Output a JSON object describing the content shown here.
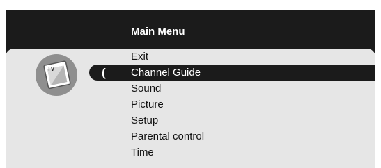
{
  "menu": {
    "title": "Main Menu",
    "icon": "tv-icon",
    "icon_label": "TV",
    "cursor_glyph": "(",
    "selected_index": 1,
    "items": [
      {
        "label": "Exit"
      },
      {
        "label": "Channel Guide"
      },
      {
        "label": "Sound"
      },
      {
        "label": "Picture"
      },
      {
        "label": "Setup"
      },
      {
        "label": "Parental control"
      },
      {
        "label": "Time"
      }
    ]
  },
  "colors": {
    "background": "#1b1b1b",
    "panel": "#e6e6e6",
    "selection": "#1b1b1b",
    "icon_circle": "#8f8f8f"
  }
}
